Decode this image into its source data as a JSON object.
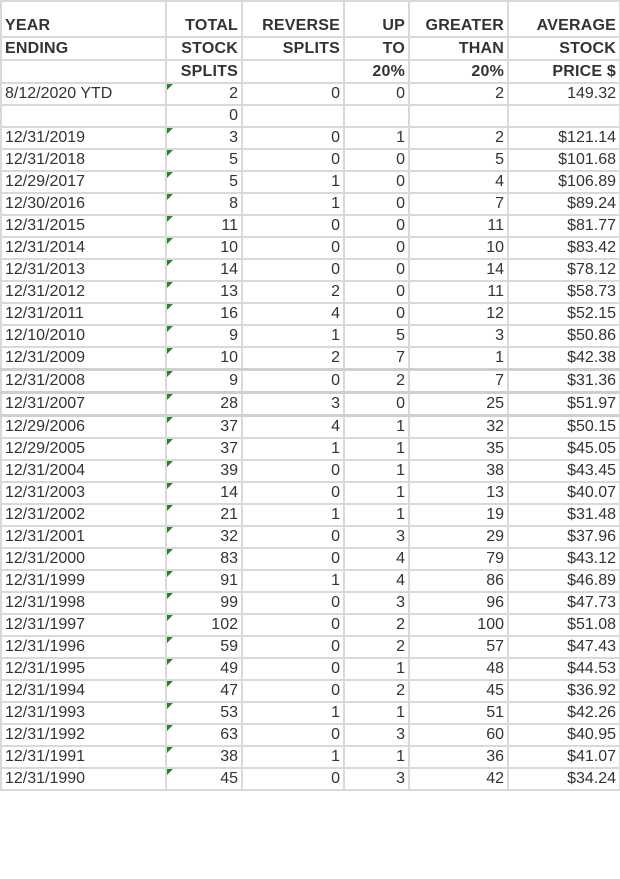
{
  "sheet": {
    "header_rows": [
      [
        "YEAR",
        "TOTAL",
        "REVERSE",
        "UP",
        "GREATER",
        "AVERAGE"
      ],
      [
        "ENDING",
        "STOCK",
        "SPLITS",
        "TO",
        "THAN",
        "STOCK"
      ],
      [
        "",
        "SPLITS",
        "",
        "20%",
        "20%",
        "PRICE $"
      ]
    ],
    "rows": [
      [
        "8/12/2020 YTD",
        "2",
        "0",
        "0",
        "2",
        "149.32"
      ],
      [
        "",
        "0",
        "",
        "",
        "",
        ""
      ],
      [
        "12/31/2019",
        "3",
        "0",
        "1",
        "2",
        "$121.14"
      ],
      [
        "12/31/2018",
        "5",
        "0",
        "0",
        "5",
        "$101.68"
      ],
      [
        "12/29/2017",
        "5",
        "1",
        "0",
        "4",
        "$106.89"
      ],
      [
        "12/30/2016",
        "8",
        "1",
        "0",
        "7",
        "$89.24"
      ],
      [
        "12/31/2015",
        "11",
        "0",
        "0",
        "11",
        "$81.77"
      ],
      [
        "12/31/2014",
        "10",
        "0",
        "0",
        "10",
        "$83.42"
      ],
      [
        "12/31/2013",
        "14",
        "0",
        "0",
        "14",
        "$78.12"
      ],
      [
        "12/31/2012",
        "13",
        "2",
        "0",
        "11",
        "$58.73"
      ],
      [
        "12/31/2011",
        "16",
        "4",
        "0",
        "12",
        "$52.15"
      ],
      [
        "12/10/2010",
        "9",
        "1",
        "5",
        "3",
        "$50.86"
      ],
      [
        "12/31/2009",
        "10",
        "2",
        "7",
        "1",
        "$42.38"
      ],
      [
        "12/31/2008",
        "9",
        "0",
        "2",
        "7",
        "$31.36"
      ],
      [
        "12/31/2007",
        "28",
        "3",
        "0",
        "25",
        "$51.97"
      ],
      [
        "12/29/2006",
        "37",
        "4",
        "1",
        "32",
        "$50.15"
      ],
      [
        "12/29/2005",
        "37",
        "1",
        "1",
        "35",
        "$45.05"
      ],
      [
        "12/31/2004",
        "39",
        "0",
        "1",
        "38",
        "$43.45"
      ],
      [
        "12/31/2003",
        "14",
        "0",
        "1",
        "13",
        "$40.07"
      ],
      [
        "12/31/2002",
        "21",
        "1",
        "1",
        "19",
        "$31.48"
      ],
      [
        "12/31/2001",
        "32",
        "0",
        "3",
        "29",
        "$37.96"
      ],
      [
        "12/31/2000",
        "83",
        "0",
        "4",
        "79",
        "$43.12"
      ],
      [
        "12/31/1999",
        "91",
        "1",
        "4",
        "86",
        "$46.89"
      ],
      [
        "12/31/1998",
        "99",
        "0",
        "3",
        "96",
        "$47.73"
      ],
      [
        "12/31/1997",
        "102",
        "0",
        "2",
        "100",
        "$51.08"
      ],
      [
        "12/31/1996",
        "59",
        "0",
        "2",
        "57",
        "$47.43"
      ],
      [
        "12/31/1995",
        "49",
        "0",
        "1",
        "48",
        "$44.53"
      ],
      [
        "12/31/1994",
        "47",
        "0",
        "2",
        "45",
        "$36.92"
      ],
      [
        "12/31/1993",
        "53",
        "1",
        "1",
        "51",
        "$42.26"
      ],
      [
        "12/31/1992",
        "63",
        "0",
        "3",
        "60",
        "$40.95"
      ],
      [
        "12/31/1991",
        "38",
        "1",
        "1",
        "36",
        "$41.07"
      ],
      [
        "12/31/1990",
        "45",
        "0",
        "3",
        "42",
        "$34.24"
      ]
    ],
    "flagged_rows": [
      0,
      2,
      3,
      4,
      5,
      6,
      7,
      8,
      9,
      10,
      11,
      12,
      13,
      14,
      15,
      16,
      17,
      18,
      19,
      20,
      21,
      22,
      23,
      24,
      25,
      26,
      27,
      28,
      29,
      30,
      31
    ],
    "thick_separator_before_rows": [
      13,
      14,
      15
    ],
    "colors": {
      "gridline": "#d9d9d9",
      "error_flag": "#1f8a1f",
      "text": "#333333"
    }
  }
}
